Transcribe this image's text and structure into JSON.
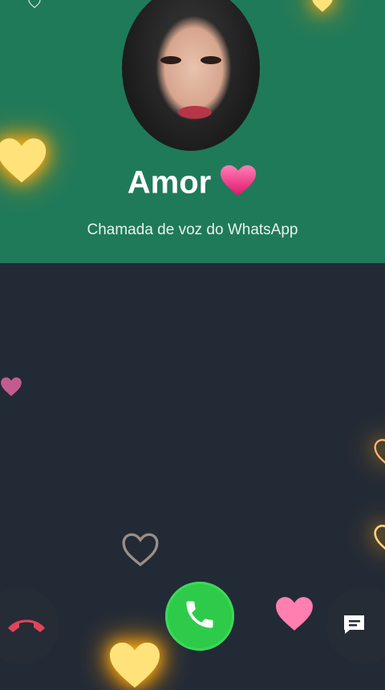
{
  "caller": {
    "name": "Amor",
    "subtitle": "Chamada de voz do WhatsApp"
  },
  "colors": {
    "header_bg": "#1f7a5a",
    "body_bg": "#222a36",
    "accept": "#2ecb4b",
    "decline_icon": "#e0455a"
  },
  "icons": {
    "name_emoji": "pink-heart-icon",
    "decline": "phone-hangup-icon",
    "accept": "phone-icon",
    "message": "message-icon"
  }
}
